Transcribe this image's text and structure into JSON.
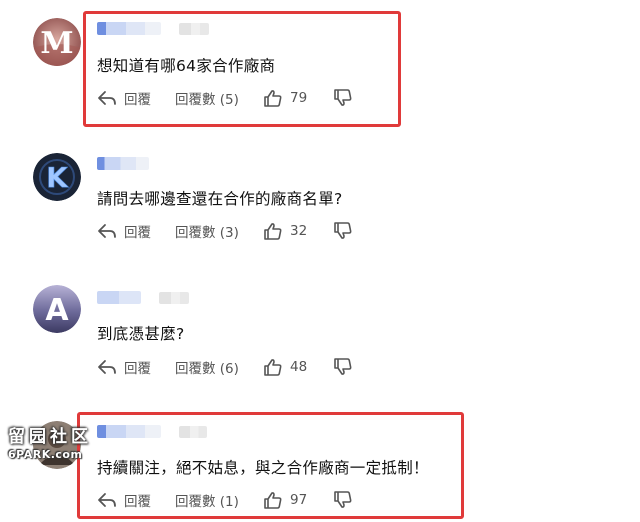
{
  "comments": [
    {
      "avatar_letter": "M",
      "text": "想知道有哪64家合作廠商",
      "reply_label": "回覆",
      "replies_label": "回覆數 (5)",
      "likes": "79"
    },
    {
      "avatar_letter": "K",
      "text": "請問去哪邊查還在合作的廠商名單?",
      "reply_label": "回覆",
      "replies_label": "回覆數 (3)",
      "likes": "32"
    },
    {
      "avatar_letter": "A",
      "text": "到底憑甚麼?",
      "reply_label": "回覆",
      "replies_label": "回覆數 (6)",
      "likes": "48"
    },
    {
      "avatar_letter": "",
      "text": "持續關注，絕不姑息，與之合作廠商一定抵制！",
      "reply_label": "回覆",
      "replies_label": "回覆數 (1)",
      "likes": "97"
    }
  ],
  "watermark": {
    "cn": "留园社区",
    "en": "6PARK.com"
  },
  "colors": {
    "highlight_frame": "#e03a3a",
    "action_text": "#555555",
    "username_blur": "#6f8fe0"
  },
  "icons": [
    "reply-arrow-icon",
    "reply-count-icon",
    "thumbs-up-icon",
    "thumbs-down-icon"
  ]
}
